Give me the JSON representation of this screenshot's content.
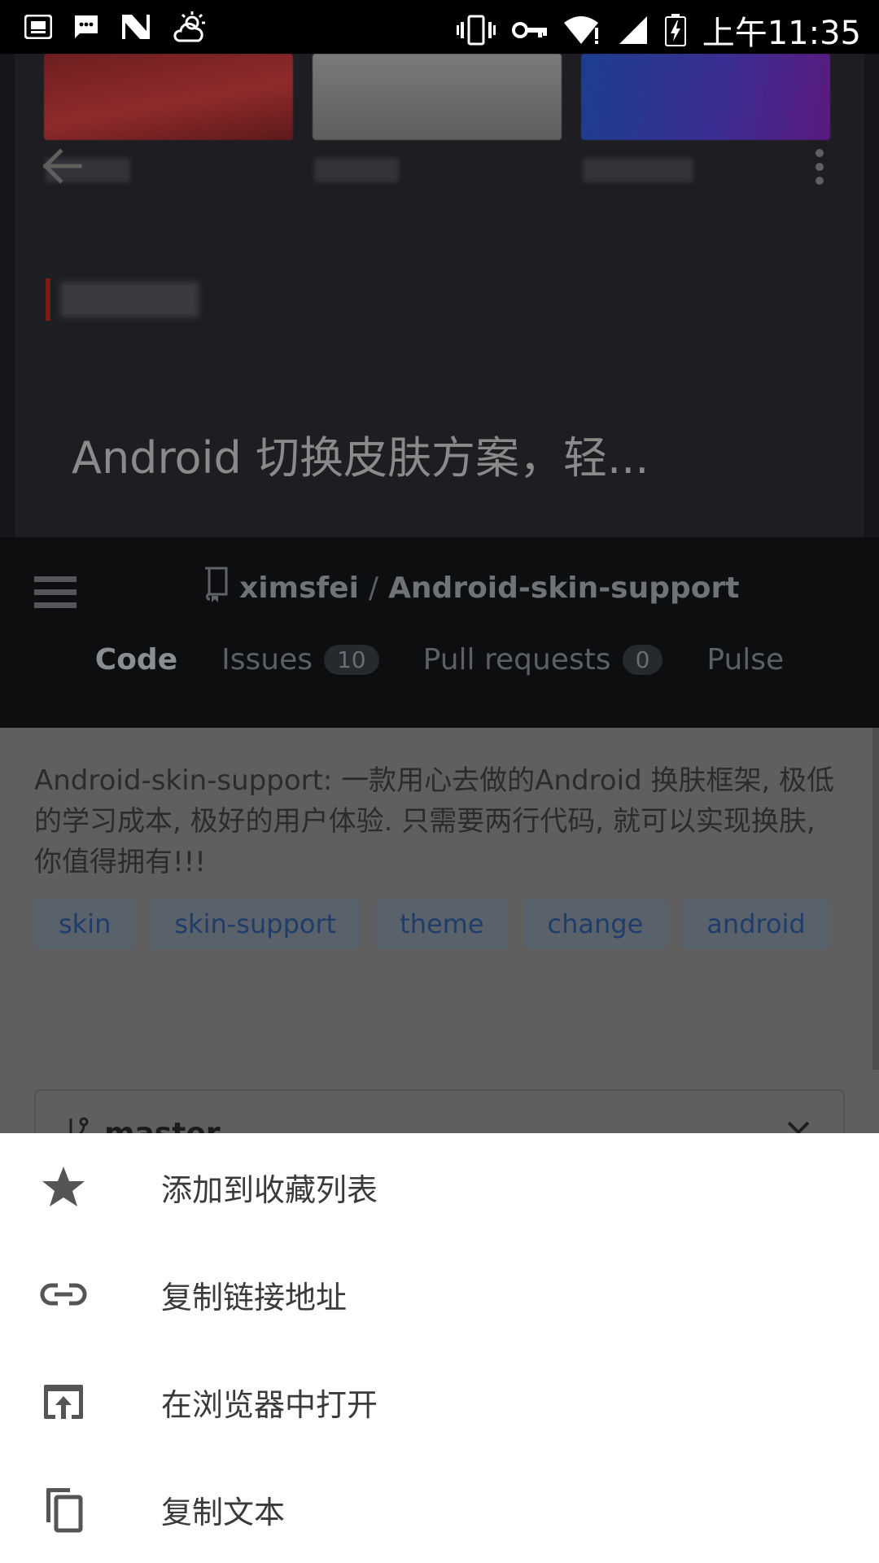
{
  "status_bar": {
    "time": "上午11:35",
    "left_icons": [
      "mail-icon",
      "sms-icon",
      "n-logo-icon",
      "weather-icon"
    ],
    "right_icons": [
      "vibrate-icon",
      "vpn-key-icon",
      "wifi-icon",
      "signal-icon",
      "battery-icon"
    ]
  },
  "hero": {
    "title": "Android 切换皮肤方案，轻...",
    "back_icon": "arrow-back-icon",
    "more_icon": "more-vert-icon"
  },
  "github_header": {
    "owner": "ximsfei",
    "separator": "/",
    "repo": "Android-skin-support",
    "tabs": [
      {
        "label": "Code",
        "count": null,
        "active": true
      },
      {
        "label": "Issues",
        "count": "10",
        "active": false
      },
      {
        "label": "Pull requests",
        "count": "0",
        "active": false
      },
      {
        "label": "Pulse",
        "count": null,
        "active": false
      }
    ]
  },
  "repo": {
    "description": "Android-skin-support: 一款用心去做的Android 换肤框架, 极低的学习成本, 极好的用户体验. 只需要两行代码, 就可以实现换肤, 你值得拥有!!!",
    "topics": [
      "skin",
      "skin-support",
      "theme",
      "change",
      "android"
    ],
    "branch": "master"
  },
  "sheet": {
    "items": [
      {
        "label": "添加到收藏列表",
        "icon": "star-icon"
      },
      {
        "label": "复制链接地址",
        "icon": "link-icon"
      },
      {
        "label": "在浏览器中打开",
        "icon": "open-in-browser-icon"
      },
      {
        "label": "复制文本",
        "icon": "copy-icon"
      }
    ]
  },
  "colors": {
    "scrim_body": "#5f5f5f",
    "sheet_bg": "#ffffff",
    "icon_gray": "#555555",
    "status_bar": "#000000"
  }
}
